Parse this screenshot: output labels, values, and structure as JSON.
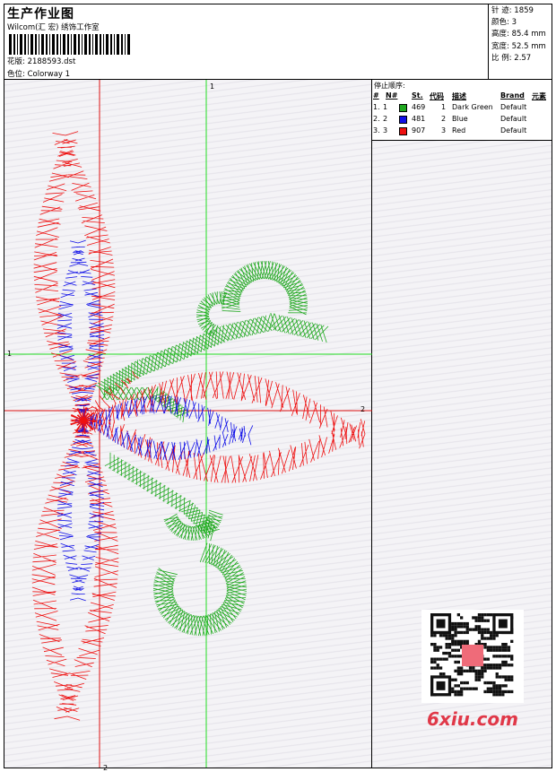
{
  "header": {
    "title": "生产作业图",
    "studio": "Wilcom(汇 宏) 绣饰工作室",
    "design_label": "花版:",
    "design_file": "2188593.dst",
    "colorway_label": "色位:",
    "colorway": "Colorway 1"
  },
  "stats": [
    {
      "label": "针 迹:",
      "value": "1859"
    },
    {
      "label": "颜色:",
      "value": "3"
    },
    {
      "label": "高度:",
      "value": "85.4 mm"
    },
    {
      "label": "宽度:",
      "value": "52.5 mm"
    },
    {
      "label": "比 例:",
      "value": "2.57"
    }
  ],
  "color_table": {
    "title": "停止顺序:",
    "headers": [
      "#",
      "N#",
      "St.",
      "代码",
      "描述",
      "Brand",
      "元素"
    ],
    "rows": [
      {
        "num": "1.",
        "n": "1",
        "color": "#1fa81f",
        "st": "469",
        "code": "1",
        "desc": "Dark Green",
        "brand": "Default"
      },
      {
        "num": "2.",
        "n": "2",
        "color": "#1010e8",
        "st": "481",
        "code": "2",
        "desc": "Blue",
        "brand": "Default"
      },
      {
        "num": "3.",
        "n": "3",
        "color": "#ee1010",
        "st": "907",
        "code": "3",
        "desc": "Red",
        "brand": "Default"
      }
    ]
  },
  "guides": {
    "green_v_label": "1",
    "green_h_label": "1",
    "red_h_label": "2",
    "red_v_label": "2"
  },
  "watermark": {
    "logo_text": "6xiu.com"
  },
  "colors": {
    "red": "#ee1010",
    "blue": "#1010e8",
    "green": "#1fa81f",
    "guide_green": "#22dd22",
    "guide_red": "#dd1111"
  }
}
